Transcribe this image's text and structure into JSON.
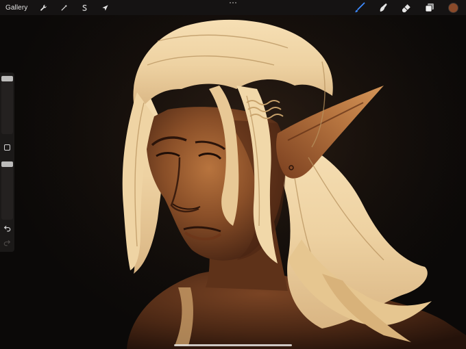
{
  "toolbar": {
    "gallery_label": "Gallery",
    "left_tools": [
      {
        "icon": "wrench-icon",
        "name": "actions"
      },
      {
        "icon": "magic-wand-icon",
        "name": "adjustments"
      },
      {
        "icon": "selection-s-icon",
        "name": "selection"
      },
      {
        "icon": "arrow-cursor-icon",
        "name": "transform"
      }
    ],
    "right_tools": [
      {
        "icon": "brush-icon",
        "name": "paint",
        "active": true
      },
      {
        "icon": "smudge-icon",
        "name": "smudge"
      },
      {
        "icon": "eraser-icon",
        "name": "erase"
      },
      {
        "icon": "layers-icon",
        "name": "layers"
      }
    ],
    "current_color": "#8a4a2a",
    "active_tool_color": "#3d8bff"
  },
  "sidebar": {
    "brush_size_level": 0.0,
    "opacity_level": 0.0,
    "undo_icon": "undo-icon",
    "redo_icon": "redo-icon",
    "modify_icon": "square-icon"
  },
  "canvas": {
    "background_color": "#0b0908",
    "subject": "artwork"
  }
}
